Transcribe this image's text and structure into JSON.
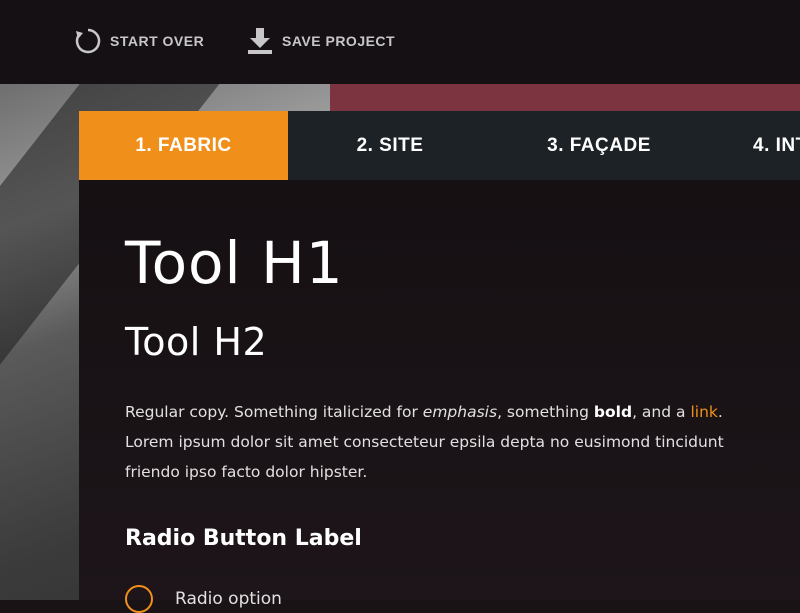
{
  "topbar": {
    "start_over": {
      "label": "START OVER",
      "icon": "refresh-icon"
    },
    "save_project": {
      "label": "SAVE PROJECT",
      "icon": "download-icon"
    }
  },
  "tabs": [
    {
      "label": "1. FABRIC",
      "active": true
    },
    {
      "label": "2. SITE",
      "active": false
    },
    {
      "label": "3. FAÇADE",
      "active": false
    },
    {
      "label": "4. INT",
      "active": false
    }
  ],
  "content": {
    "h1": "Tool H1",
    "h2": "Tool H2",
    "copy": {
      "p1_before_em": "Regular copy. Something italicized for ",
      "em": "emphasis",
      "p1_between": ", something ",
      "bold": "bold",
      "p1_before_link": ", and a ",
      "link": "link",
      "p1_end": ".",
      "lorem": "Lorem ipsum dolor sit amet consecteteur epsila depta no eusimond tincidunt friendo ipso facto dolor hipster."
    },
    "radio_label": "Radio Button Label",
    "radio_option": "Radio option"
  },
  "colors": {
    "accent": "#f0901b",
    "tab_bar": "#1d2227",
    "panel": "#140f12",
    "topbar": "#151013"
  }
}
